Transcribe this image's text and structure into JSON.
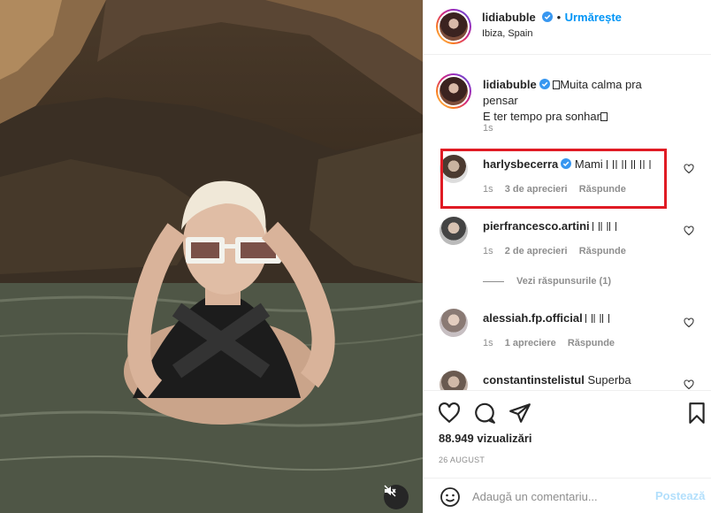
{
  "post": {
    "username": "lidiabuble",
    "follow_label": "Urmărește",
    "location": "Ibiza, Spain"
  },
  "caption": {
    "username": "lidiabuble",
    "line1": "Muita calma pra pensar",
    "line2": "E ter tempo pra sonhar",
    "time": "1s"
  },
  "comments": [
    {
      "username": "harlysbecerra",
      "verified": true,
      "text": "Mami ",
      "time": "1s",
      "likes": "3 de aprecieri",
      "reply": "Răspunde",
      "highlighted": true
    },
    {
      "username": "pierfrancesco.artini",
      "verified": false,
      "text": "",
      "time": "1s",
      "likes": "2 de aprecieri",
      "reply": "Răspunde"
    },
    {
      "username": "alessiah.fp.official",
      "verified": false,
      "text": "",
      "time": "1s",
      "likes": "1 apreciere",
      "reply": "Răspunde"
    },
    {
      "username": "constantinstelistul",
      "verified": false,
      "text": "Superba",
      "time": "",
      "likes": "",
      "reply": ""
    }
  ],
  "view_replies_label": "Vezi răspunsurile (1)",
  "footer": {
    "views": "88.949 vizualizări",
    "date": "26 AUGUST",
    "comment_placeholder": "Adaugă un comentariu...",
    "post_label": "Postează"
  },
  "icons": {
    "like": "heart-icon",
    "comment": "comment-icon",
    "share": "share-icon",
    "save": "bookmark-icon",
    "emoji": "emoji-icon",
    "mute": "muted-speaker-icon",
    "verified": "verified-badge-icon"
  },
  "colors": {
    "accent": "#0095f6",
    "highlight_border": "#e01b24",
    "muted_text": "#8e8e8e"
  }
}
